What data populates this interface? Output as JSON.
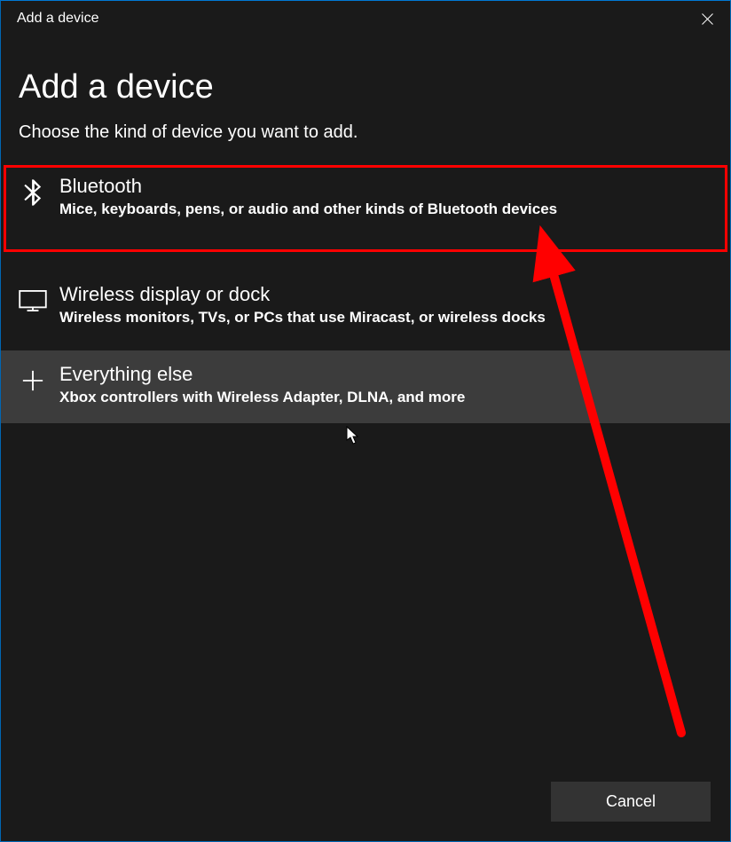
{
  "titlebar": {
    "title": "Add a device"
  },
  "header": {
    "title": "Add a device",
    "subtitle": "Choose the kind of device you want to add."
  },
  "options": [
    {
      "icon": "bluetooth-icon",
      "title": "Bluetooth",
      "desc": "Mice, keyboards, pens, or audio and other kinds of Bluetooth devices",
      "highlighted": true,
      "hover": false
    },
    {
      "icon": "monitor-icon",
      "title": "Wireless display or dock",
      "desc": "Wireless monitors, TVs, or PCs that use Miracast, or wireless docks",
      "highlighted": false,
      "hover": false
    },
    {
      "icon": "plus-icon",
      "title": "Everything else",
      "desc": "Xbox controllers with Wireless Adapter, DLNA, and more",
      "highlighted": false,
      "hover": true
    }
  ],
  "footer": {
    "cancel": "Cancel"
  },
  "annotation": {
    "highlight_color": "#ff0000"
  }
}
